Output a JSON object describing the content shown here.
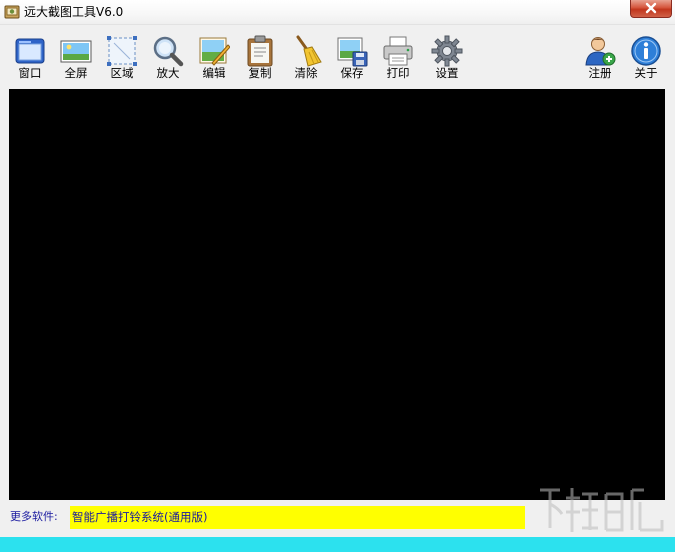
{
  "window": {
    "title": "远大截图工具V6.0"
  },
  "toolbar": {
    "items": [
      {
        "label": "窗口",
        "icon": "window-icon"
      },
      {
        "label": "全屏",
        "icon": "fullscreen-icon"
      },
      {
        "label": "区域",
        "icon": "region-select-icon"
      },
      {
        "label": "放大",
        "icon": "magnifier-icon"
      },
      {
        "label": "编辑",
        "icon": "edit-picture-icon"
      },
      {
        "label": "复制",
        "icon": "clipboard-icon"
      },
      {
        "label": "清除",
        "icon": "broom-icon"
      },
      {
        "label": "保存",
        "icon": "save-picture-icon"
      },
      {
        "label": "打印",
        "icon": "printer-icon"
      },
      {
        "label": "设置",
        "icon": "gear-icon"
      },
      {
        "label": "注册",
        "icon": "user-register-icon"
      },
      {
        "label": "关于",
        "icon": "info-icon"
      }
    ]
  },
  "footer": {
    "more_label": "更多软件:",
    "promo_text": "智能广播打铃系统(通用版)"
  },
  "colors": {
    "canvas": "#000000",
    "promo_bg": "#ffff00",
    "status_bar": "#2ce1ee",
    "link_text": "#1a1aa0"
  }
}
